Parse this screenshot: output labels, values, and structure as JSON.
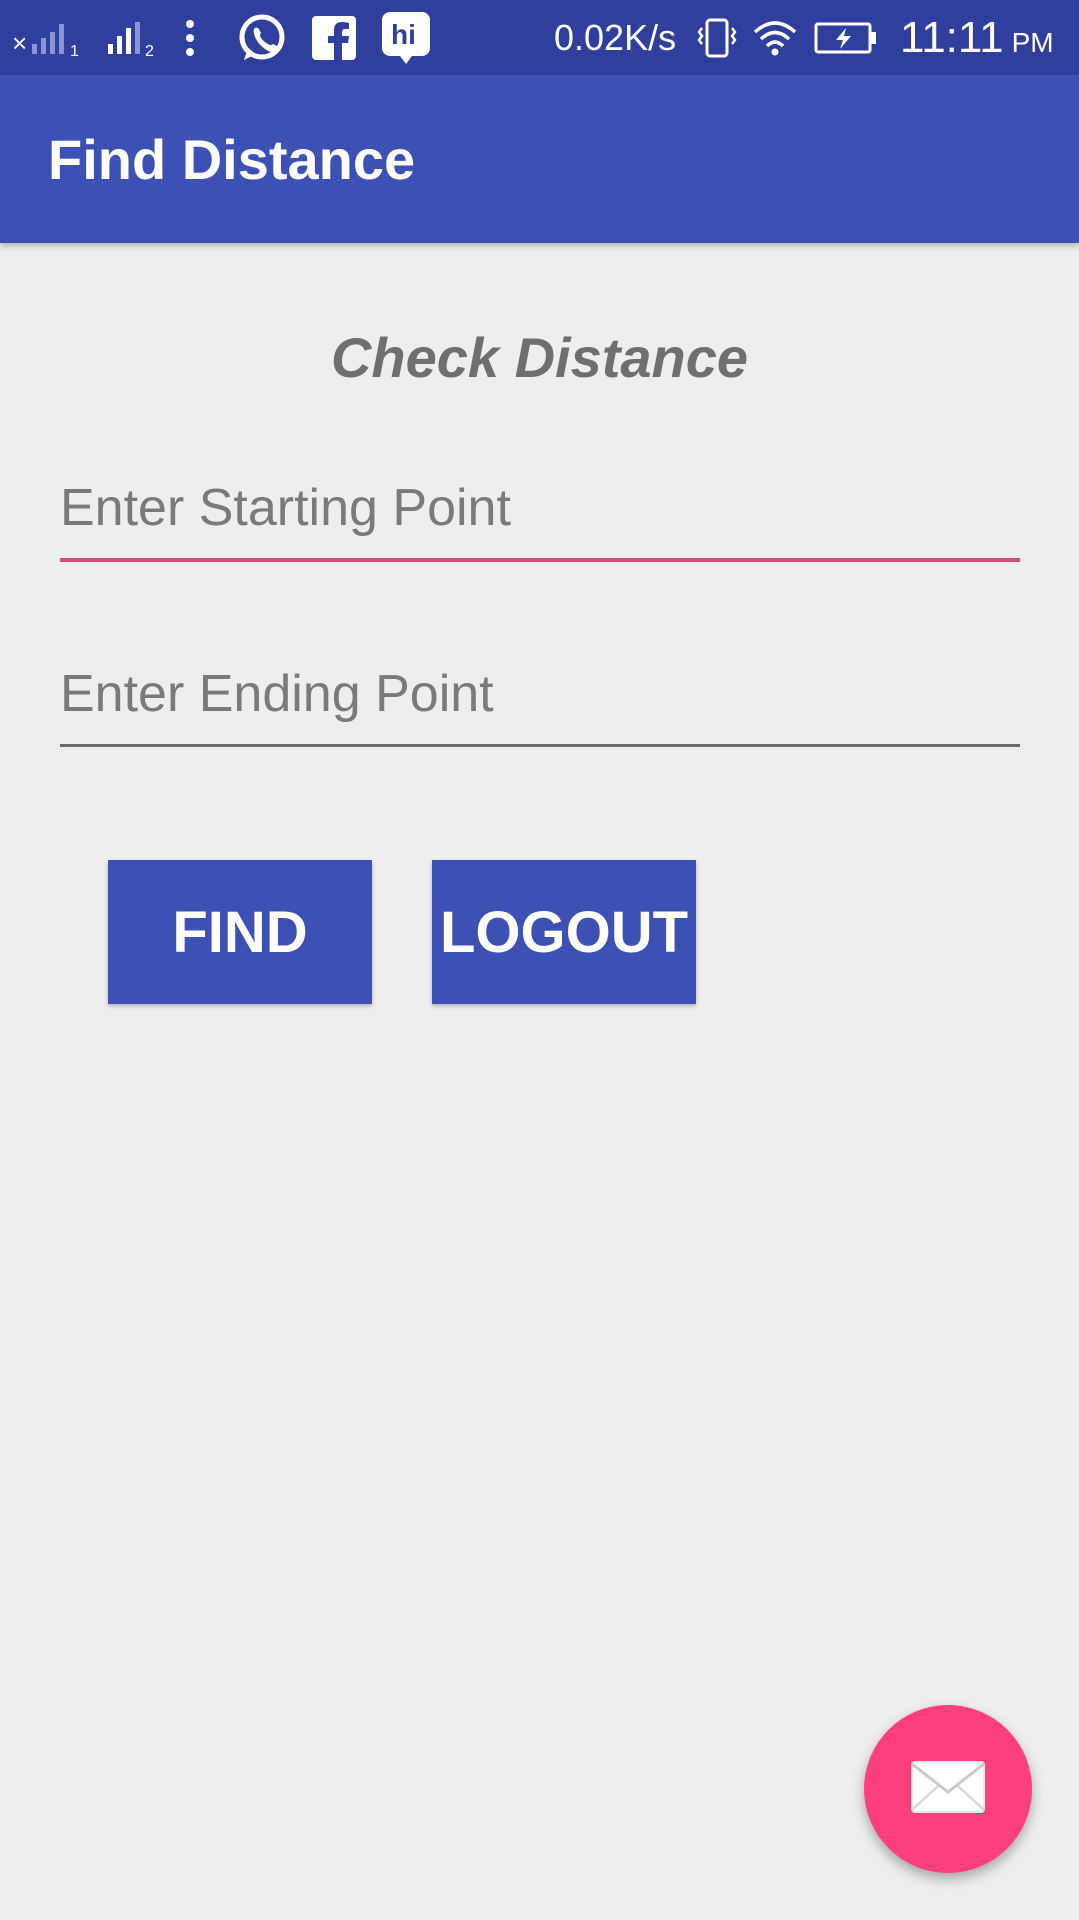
{
  "status_bar": {
    "network_speed": "0.02K/s",
    "time": "11:11",
    "am_pm": "PM",
    "sim1_label": "1",
    "sim2_label": "2",
    "icons": [
      "signal-sim1-icon",
      "signal-sim2-icon",
      "more-icon",
      "whatsapp-icon",
      "facebook-icon",
      "hike-icon",
      "vibrate-icon",
      "wifi-icon",
      "battery-charging-icon"
    ]
  },
  "app_bar": {
    "title": "Find Distance"
  },
  "main": {
    "heading": "Check Distance",
    "start_field": {
      "placeholder": "Enter Starting Point",
      "value": ""
    },
    "end_field": {
      "placeholder": "Enter Ending Point",
      "value": ""
    },
    "find_label": "FIND",
    "logout_label": "LOGOUT"
  },
  "fab": {
    "icon": "mail-icon"
  },
  "colors": {
    "status_bar": "#2f3f9b",
    "primary": "#3d51b4",
    "accent": "#fd3f7e",
    "background": "#eeeeef"
  }
}
